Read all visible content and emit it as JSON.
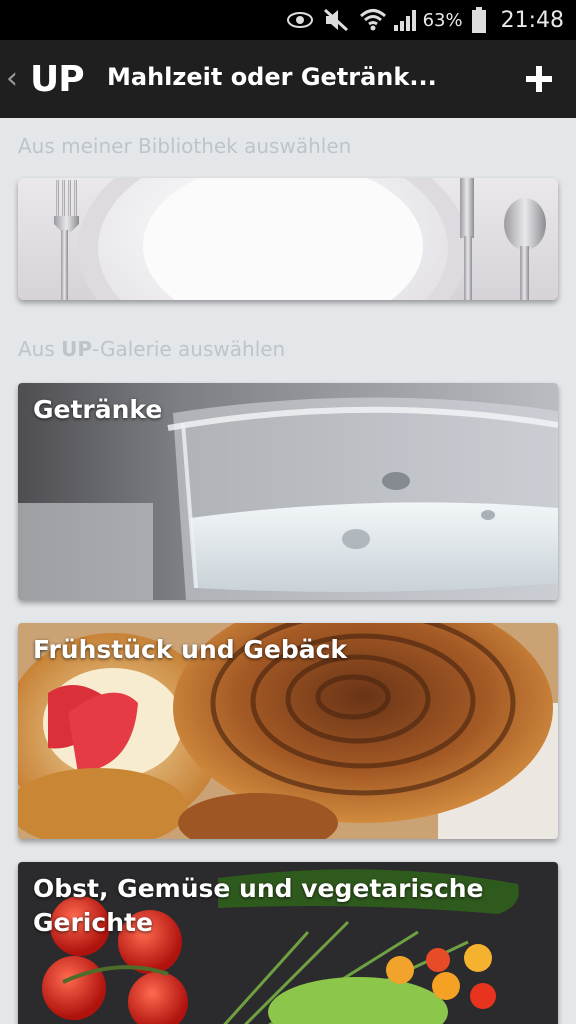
{
  "status_bar": {
    "battery_percent": "63%",
    "time": "21:48",
    "icons": [
      "eye-icon",
      "mute-icon",
      "wifi-icon",
      "signal-icon",
      "battery-icon"
    ]
  },
  "action_bar": {
    "back_symbol": "‹",
    "logo": "UP",
    "title": "Mahlzeit oder Getränk...",
    "add_symbol": "+"
  },
  "library_section": {
    "label": "Aus meiner Bibliothek auswählen"
  },
  "gallery_section": {
    "label_prefix": "Aus ",
    "label_brand": "UP",
    "label_suffix": "-Galerie auswählen"
  },
  "categories": [
    {
      "title": "Getränke"
    },
    {
      "title": "Frühstück und Gebäck"
    },
    {
      "title": "Obst, Gemüse und vegetarische Gerichte"
    }
  ]
}
